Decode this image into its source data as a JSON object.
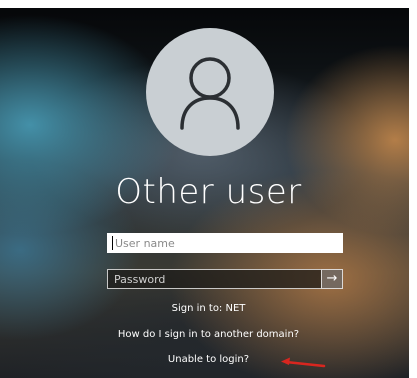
{
  "user": {
    "display_name": "Other user",
    "avatar_icon": "person-icon"
  },
  "login_form": {
    "username_placeholder": "User name",
    "password_placeholder": "Password",
    "submit_icon": "arrow-right-icon",
    "submit_arrow": "→"
  },
  "sign_in_to": "Sign in to: NET",
  "links": {
    "another_domain": "How do I sign in to another domain?",
    "unable_to_login": "Unable to login?"
  },
  "annotation": {
    "arrow_icon": "red-arrow-icon",
    "color": "#d8261f"
  },
  "colors": {
    "text": "#ffffff",
    "avatar_bg": "#c9cfd3",
    "avatar_stroke": "#2b2f33"
  }
}
